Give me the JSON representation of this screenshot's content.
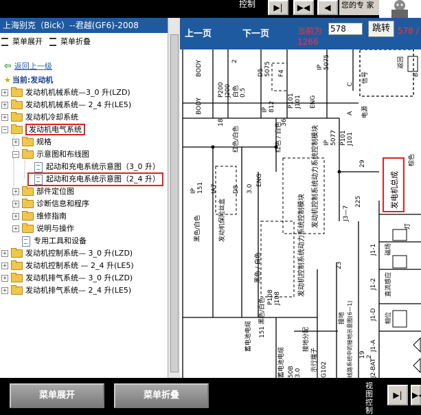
{
  "top": {
    "control_label": "控制",
    "status_text": "您的专\n家",
    "buttons": [
      "▶|",
      "▶◀",
      "◀"
    ]
  },
  "left_panel": {
    "title": "上海别克（Bick）--君越(GF6)-2008",
    "expand_label": "菜单展开",
    "collapse_label": "菜单折叠",
    "back_label": "返回上一级",
    "current_label": "当前:发动机",
    "tree": [
      {
        "label": "发动机机械系统—3_0 升(LZD)",
        "type": "folder",
        "toggle": "+",
        "level": 0
      },
      {
        "label": "发动机机械系统— 2_4 升(LE5)",
        "type": "folder",
        "toggle": "+",
        "level": 0
      },
      {
        "label": "发动机冷却系统",
        "type": "folder",
        "toggle": "+",
        "level": 0
      },
      {
        "label": "发动机电气系统",
        "type": "folder",
        "toggle": "−",
        "level": 0,
        "highlight": true
      },
      {
        "label": "规格",
        "type": "folder",
        "toggle": "+",
        "level": 1
      },
      {
        "label": "示意图和布线图",
        "type": "folder",
        "toggle": "−",
        "level": 1
      },
      {
        "label": "起动和充电系统示意图（3_0 升）",
        "type": "doc",
        "level": 2
      },
      {
        "label": "起动和充电系统示意图（2_4 升）",
        "type": "doc",
        "level": 2,
        "highlight": true
      },
      {
        "label": "部件定位图",
        "type": "folder",
        "toggle": "+",
        "level": 1
      },
      {
        "label": "诊断信息和程序",
        "type": "folder",
        "toggle": "+",
        "level": 1
      },
      {
        "label": "维修指南",
        "type": "folder",
        "toggle": "+",
        "level": 1
      },
      {
        "label": "说明与操作",
        "type": "folder",
        "toggle": "+",
        "level": 1
      },
      {
        "label": "专用工具和设备",
        "type": "doc",
        "level": 1
      },
      {
        "label": "发动机控制系统— 3_0 升(LZD)",
        "type": "folder",
        "toggle": "+",
        "level": 0
      },
      {
        "label": "发动机控制系统 — 2_4 升(LE5)",
        "type": "folder",
        "toggle": "+",
        "level": 0
      },
      {
        "label": "发动机排气系统— 3_0 升(LZD)",
        "type": "folder",
        "toggle": "+",
        "level": 0
      },
      {
        "label": "发动机排气系统— 2_4 升(LE5)",
        "type": "folder",
        "toggle": "+",
        "level": 0
      }
    ]
  },
  "nav": {
    "prev_label": "上一页",
    "next_label": "下一页",
    "current_prefix": "当前为",
    "page_value": "578",
    "jump_label": "跳转",
    "total_a": "578 /",
    "total_b": "1266"
  },
  "diagram": {
    "texts": {
      "body1": "BODY",
      "p200": "P200",
      "j200": "J200",
      "n2": "2",
      "body2": "BODY",
      "n18": "18",
      "w_white": "白色",
      "n05": "0.5",
      "d5": "D5",
      "n5075": "5075",
      "f4": "F4",
      "ip1": "IP",
      "n812": "812",
      "p101": "P101",
      "j101": "J101",
      "n36": "36",
      "eng1": "ENG",
      "ip2": "IP",
      "n5075b": "5075",
      "c": "C",
      "a": "A",
      "b": "B",
      "sig": "信号",
      "power": "电源",
      "ret": "返回",
      "red_white": "红色/白色",
      "red_white2": "红色 / 白色",
      "n5077": "5077",
      "ip3": "IP",
      "p101b": "P101",
      "j101b": "J101",
      "n29": "29",
      "gen": "发电机总成",
      "brown_white": "棕色",
      "ip4": "IP",
      "n151": "151",
      "ia7": "IA7",
      "d8": "D8",
      "n3": "3.0",
      "eng2": "ENG",
      "black_white": "黑色/白色",
      "black_white2": "黑色 / 白色",
      "fuse": "发动机保险丝盒",
      "ecm": "发动机控制系统动力系统控制模块",
      "ecm2": "发动机控制系统动力系统控制模块",
      "j3": "J3—7",
      "n225": "225",
      "n23": "23",
      "j11": "J1-1",
      "j12": "J1-2",
      "j1d": "J1-D",
      "j1a": "J1-A",
      "j2bat": "J2-BAT",
      "p108": "P108",
      "j108": "J108",
      "n151b": "151 黑色/白色",
      "batt": "蓄电池电缆",
      "batt2": "蓄电池电缆",
      "n50b": "50B",
      "n30": "3.0",
      "gnd": "接地分配",
      "ghost": "G102",
      "cap": "示行端子",
      "ground2": "接地",
      "n19": "19",
      "n2b": "2",
      "note": "线路系统中的接地示意图(6—1)",
      "lamp": "灯",
      "bulb": "磁场",
      "wind": "直流感应",
      "phase": "相位"
    }
  },
  "bottom": {
    "expand_label": "菜单展开",
    "collapse_label": "菜单折叠",
    "side_label": "视图控制",
    "btn1": "▶|",
    "btn2": "▶◀"
  }
}
